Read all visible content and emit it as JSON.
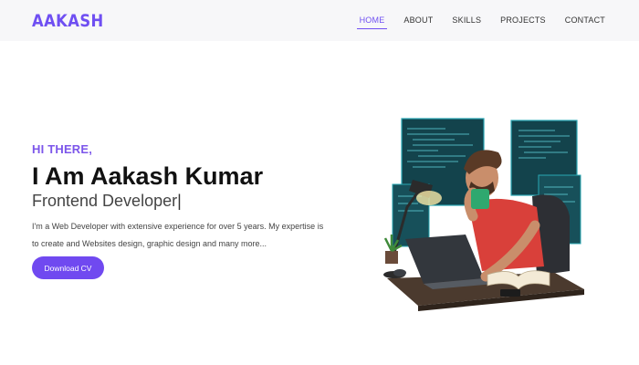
{
  "brand": {
    "logo_text": "AAKASH",
    "color": "#6f4ff2"
  },
  "nav": {
    "items": [
      {
        "label": "HOME",
        "active": true
      },
      {
        "label": "ABOUT",
        "active": false
      },
      {
        "label": "SKILLS",
        "active": false
      },
      {
        "label": "PROJECTS",
        "active": false
      },
      {
        "label": "CONTACT",
        "active": false
      }
    ]
  },
  "hero": {
    "greeting": "HI THERE,",
    "name": "I Am Aakash Kumar",
    "role": "Frontend Developer",
    "role_cursor": "|",
    "description": "I'm a Web Developer with extensive experience for over 5 years. My expertise is to create and Websites design, graphic design and many more...",
    "cta_label": "Download CV",
    "accent_color": "#7049f0"
  },
  "illustration": {
    "subject": "developer-drinking-coffee-at-laptop",
    "icon": "developer-illustration-icon"
  }
}
